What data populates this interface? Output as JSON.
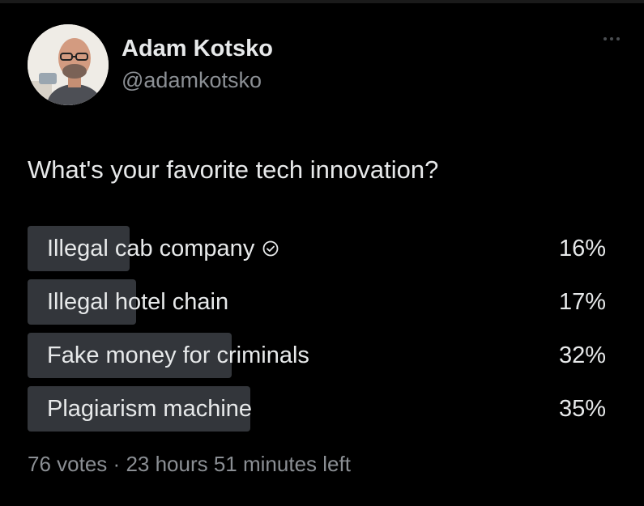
{
  "author": {
    "display_name": "Adam Kotsko",
    "handle": "@adamkotsko"
  },
  "poll": {
    "question": "What's your favorite tech innovation?",
    "options": [
      {
        "label": "Illegal cab company",
        "percent_text": "16%",
        "percent": 16,
        "selected": true
      },
      {
        "label": "Illegal hotel chain",
        "percent_text": "17%",
        "percent": 17,
        "selected": false
      },
      {
        "label": "Fake money for criminals",
        "percent_text": "32%",
        "percent": 32,
        "selected": false
      },
      {
        "label": "Plagiarism machine",
        "percent_text": "35%",
        "percent": 35,
        "selected": false
      }
    ],
    "votes": "76 votes",
    "separator": "·",
    "time_left": "23 hours 51 minutes left"
  },
  "icons": {
    "more": "more-dots-icon",
    "selected": "check-circle-icon"
  },
  "colors": {
    "background": "#000000",
    "bar": "#33363b",
    "text": "#e7e9ea",
    "muted": "#8b8f94"
  }
}
